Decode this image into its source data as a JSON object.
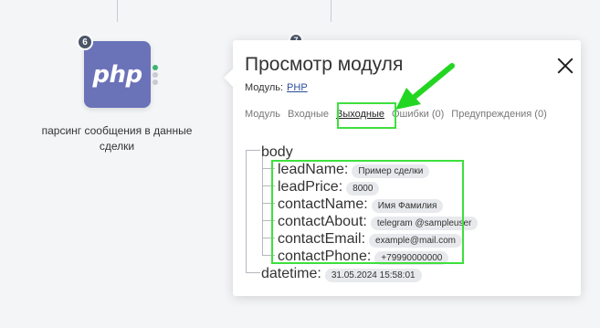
{
  "canvas": {
    "node": {
      "badge": "6",
      "logo_text": "php",
      "caption": "парсинг сообщения в данные сделки"
    },
    "second_badge": "7"
  },
  "panel": {
    "title": "Просмотр модуля",
    "module_label": "Модуль:",
    "module_value": "PHP",
    "tabs": [
      {
        "label": "Модуль"
      },
      {
        "label": "Входные"
      },
      {
        "label": "Выходные",
        "active": true
      },
      {
        "label": "Ошибки (0)"
      },
      {
        "label": "Предупреждения (0)"
      }
    ],
    "tree": {
      "root": "body",
      "fields": [
        {
          "key": "leadName:",
          "value": "Пример сделки"
        },
        {
          "key": "leadPrice:",
          "value": "8000"
        },
        {
          "key": "contactName:",
          "value": "Имя Фамилия"
        },
        {
          "key": "contactAbout:",
          "value": "telegram @sampleuser"
        },
        {
          "key": "contactEmail:",
          "value": "example@mail.com"
        },
        {
          "key": "contactPhone:",
          "value": "+79990000000"
        }
      ],
      "tail": {
        "key": "datetime:",
        "value": "31.05.2024 15:58:01"
      }
    }
  },
  "colors": {
    "node_bg": "#6a72b8",
    "highlight": "#3ee03e",
    "link": "#2a4d9b"
  }
}
